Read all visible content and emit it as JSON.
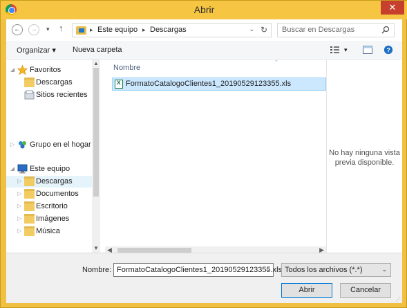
{
  "window": {
    "title": "Abrir",
    "close_glyph": "✕"
  },
  "nav": {
    "back_glyph": "←",
    "forward_glyph": "→",
    "history_glyph": "▾",
    "up_glyph": "↑",
    "breadcrumb": [
      "Este equipo",
      "Descargas"
    ],
    "refresh_glyph": "↻",
    "dropdown_glyph": "⌄"
  },
  "search": {
    "placeholder": "Buscar en Descargas"
  },
  "toolbar": {
    "organize_label": "Organizar",
    "organize_caret": "▾",
    "new_folder_label": "Nueva carpeta",
    "view_caret": "▾"
  },
  "sidebar": {
    "items": [
      {
        "label": "Favoritos",
        "icon": "star-icon"
      },
      {
        "label": "Descargas",
        "icon": "downloads-folder-icon"
      },
      {
        "label": "Sitios recientes",
        "icon": "recent-places-icon"
      },
      {
        "label": "Grupo en el hogar",
        "icon": "homegroup-icon"
      },
      {
        "label": "Este equipo",
        "icon": "computer-icon"
      },
      {
        "label": "Descargas",
        "icon": "downloads-folder-icon"
      },
      {
        "label": "Documentos",
        "icon": "documents-folder-icon"
      },
      {
        "label": "Escritorio",
        "icon": "desktop-folder-icon"
      },
      {
        "label": "Imágenes",
        "icon": "pictures-folder-icon"
      },
      {
        "label": "Música",
        "icon": "music-folder-icon"
      }
    ]
  },
  "files": {
    "column_header": "Nombre",
    "items": [
      {
        "name": "FormatoCatalogoClientes1_20190529123355.xls",
        "icon": "excel-file-icon"
      }
    ]
  },
  "preview": {
    "line1": "No hay ninguna vista",
    "line2": "previa disponible."
  },
  "footer": {
    "name_label": "Nombre:",
    "name_value": "FormatoCatalogoClientes1_20190529123355.xls",
    "filter_value": "Todos los archivos (*.*)",
    "open_label": "Abrir",
    "cancel_label": "Cancelar"
  },
  "colors": {
    "title_bar": "#f6c542",
    "close_button": "#c6402d",
    "selection": "#cce8ff",
    "accent_border": "#0078d7"
  }
}
